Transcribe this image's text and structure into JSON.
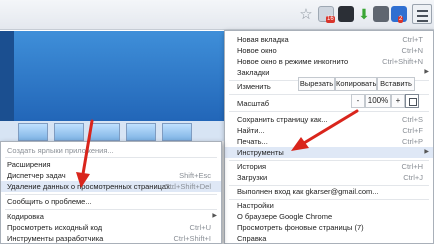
{
  "toolbar": {
    "ext_badge_1": "16",
    "ext_badge_2": "2"
  },
  "main_menu": {
    "new_tab": {
      "label": "Новая вкладка",
      "shortcut": "Ctrl+T"
    },
    "new_window": {
      "label": "Новое окно",
      "shortcut": "Ctrl+N"
    },
    "incognito": {
      "label": "Новое окно в режиме инкогнито",
      "shortcut": "Ctrl+Shift+N"
    },
    "bookmarks": {
      "label": "Закладки"
    },
    "edit_label": "Изменить",
    "cut": "Вырезать",
    "copy": "Копировать",
    "paste": "Вставить",
    "zoom_label": "Масштаб",
    "zoom_minus": "-",
    "zoom_value": "100%",
    "zoom_plus": "+",
    "save_page": {
      "label": "Сохранить страницу как...",
      "shortcut": "Ctrl+S"
    },
    "find": {
      "label": "Найти...",
      "shortcut": "Ctrl+F"
    },
    "print": {
      "label": "Печать...",
      "shortcut": "Ctrl+P"
    },
    "tools": {
      "label": "Инструменты"
    },
    "history": {
      "label": "История",
      "shortcut": "Ctrl+H"
    },
    "downloads": {
      "label": "Загрузки",
      "shortcut": "Ctrl+J"
    },
    "signed_in": {
      "label": "Выполнен вход как gkarser@gmail.com..."
    },
    "settings": {
      "label": "Настройки"
    },
    "about": {
      "label": "О браузере Google Chrome"
    },
    "background_pages": {
      "label": "Просмотреть фоновые страницы (7)"
    },
    "help": {
      "label": "Справка"
    }
  },
  "sub_menu": {
    "create_shortcuts": {
      "label": "Создать ярлыки приложения..."
    },
    "extensions": {
      "label": "Расширения"
    },
    "task_manager": {
      "label": "Диспетчер задач",
      "shortcut": "Shift+Esc"
    },
    "clear_data": {
      "label": "Удаление данных о просмотренных страницах...",
      "shortcut": "Ctrl+Shift+Del"
    },
    "report_issue": {
      "label": "Сообщить о проблеме..."
    },
    "encoding": {
      "label": "Кодировка"
    },
    "view_source": {
      "label": "Просмотреть исходный код",
      "shortcut": "Ctrl+U"
    },
    "dev_tools": {
      "label": "Инструменты разработчика",
      "shortcut": "Ctrl+Shift+I"
    }
  },
  "colors": {
    "highlight": "#dfe8f6",
    "annotation_arrow": "#d9251c",
    "menu_border": "#a9b0b9"
  }
}
